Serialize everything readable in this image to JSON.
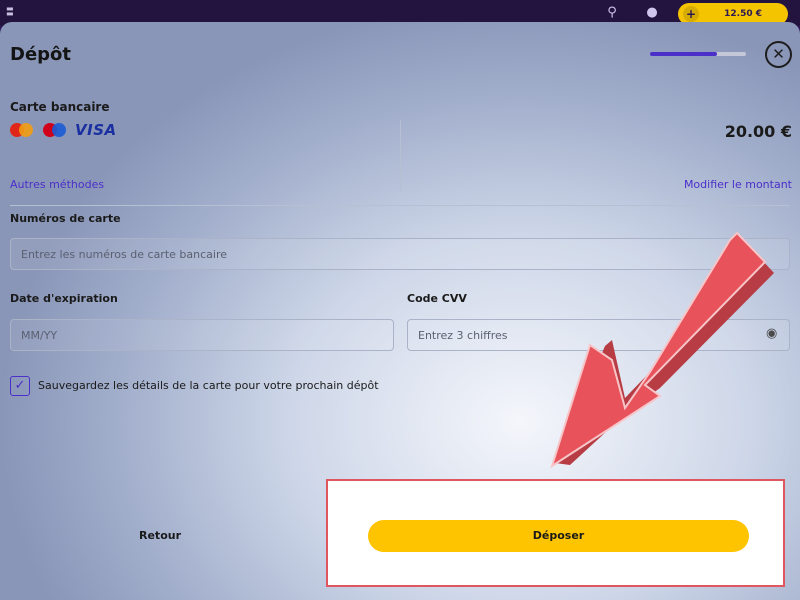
{
  "topbar": {
    "logo_icon": "menu-logo-icon",
    "search_icon": "search-icon",
    "notification_icon": "bell-icon",
    "balance": "12.50 €",
    "add_icon": "plus-icon"
  },
  "modal": {
    "title": "Dépôt",
    "progress_fraction": 0.7,
    "close_icon": "close-icon"
  },
  "payment": {
    "method_label": "Carte bancaire",
    "logos": [
      "mastercard-logo",
      "maestro-logo",
      "visa-logo"
    ],
    "visa_text": "VISA",
    "other_methods_link": "Autres méthodes",
    "amount": "20.00 €",
    "modify_amount_link": "Modifier le montant"
  },
  "form": {
    "card_number_label": "Numéros de carte",
    "card_number_placeholder": "Entrez les numéros de carte bancaire",
    "card_number_value": "",
    "expiry_label": "Date d'expiration",
    "expiry_placeholder": "MM/YY",
    "expiry_value": "",
    "cvv_label": "Code CVV",
    "cvv_placeholder": "Entrez 3 chiffres",
    "cvv_value": "",
    "cvv_eye_icon": "eye-icon",
    "save_card_checked": true,
    "save_card_label": "Sauvegardez les détails de la carte pour votre prochain dépôt"
  },
  "actions": {
    "back_label": "Retour",
    "deposit_label": "Déposer"
  },
  "colors": {
    "accent": "#4b2fc9",
    "deposit_button": "#ffc400",
    "highlight_border": "#e0565e",
    "arrow": "#e8525b"
  }
}
